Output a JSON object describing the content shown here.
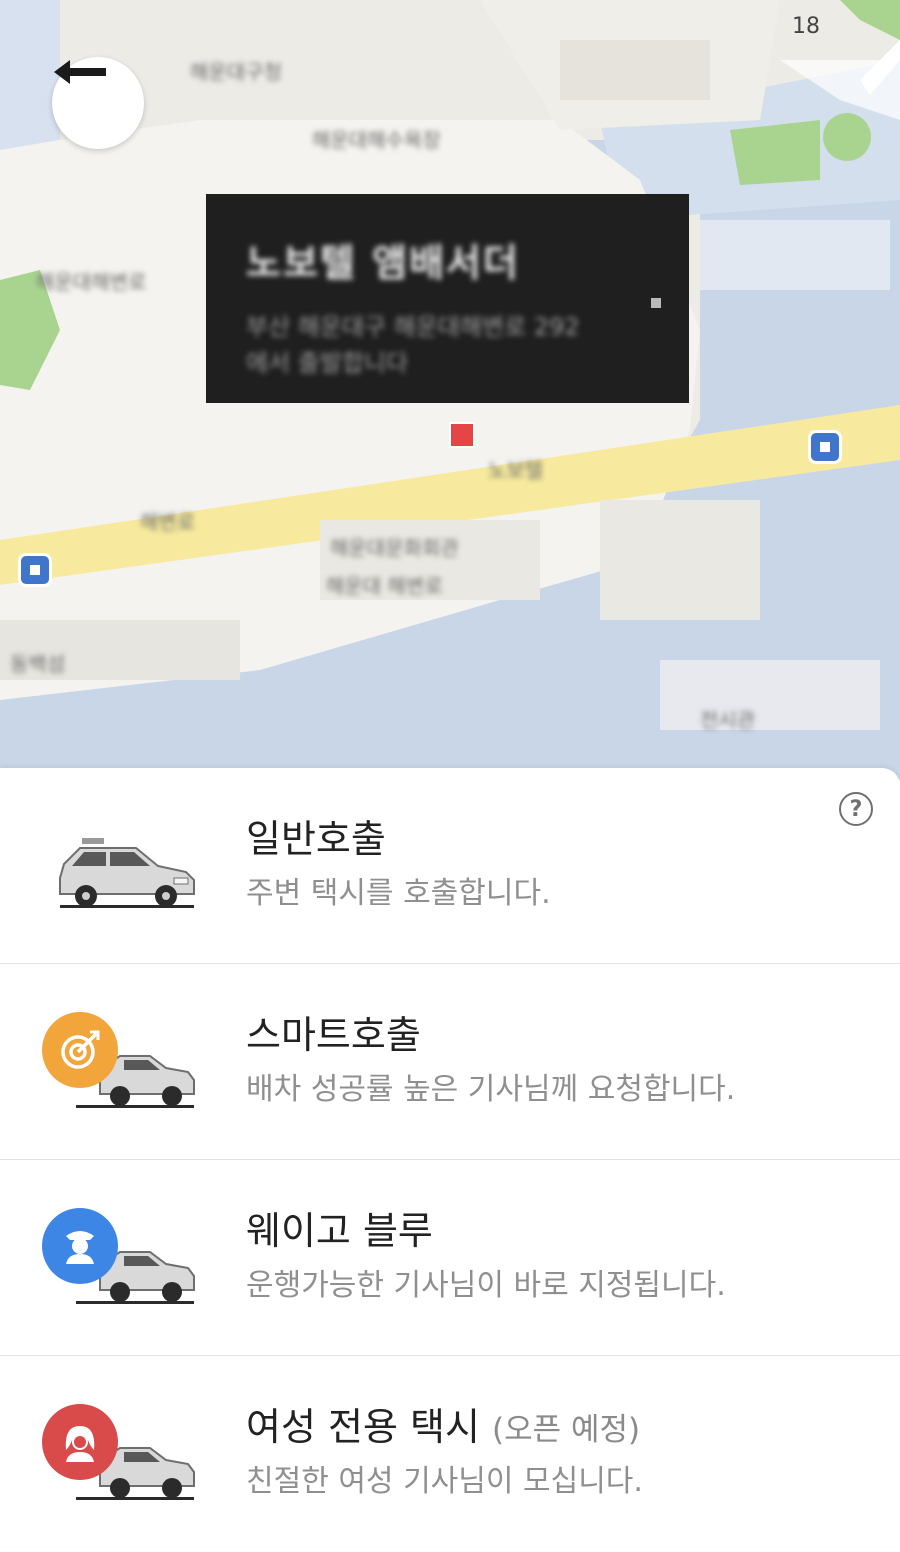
{
  "map": {
    "zoom_level": "18",
    "tooltip_title": "노보텔 앰배서더",
    "tooltip_address_1": "부산 해운대구 해운대해변로 292",
    "tooltip_address_2": "에서 출발합니다",
    "labels": [
      "해운대구청",
      "해운대해수욕장",
      "해운대해변로",
      "노보텔",
      "해운대문화회관",
      "해운대 해변로",
      "동백섬",
      "해변로",
      "전시관"
    ]
  },
  "sheet": {
    "help_label": "?",
    "options": [
      {
        "title": "일반호출",
        "tag": "",
        "desc": "주변 택시를 호출합니다.",
        "icon": "taxi-car-icon"
      },
      {
        "title": "스마트호출",
        "tag": "",
        "desc": "배차 성공률 높은 기사님께 요청합니다.",
        "icon": "target-icon",
        "badge_color": "#f2a53a"
      },
      {
        "title": "웨이고 블루",
        "tag": "",
        "desc": "운행가능한 기사님이 바로 지정됩니다.",
        "icon": "driver-icon",
        "badge_color": "#3d86e6"
      },
      {
        "title": "여성 전용 택시",
        "tag": "(오픈 예정)",
        "desc": "친절한 여성 기사님이 모십니다.",
        "icon": "woman-icon",
        "badge_color": "#d94b4b"
      }
    ]
  },
  "colors": {
    "road": "#f7ea9e",
    "water": "#c9d6e8",
    "park": "#a9d490",
    "land": "#ecebe6"
  }
}
